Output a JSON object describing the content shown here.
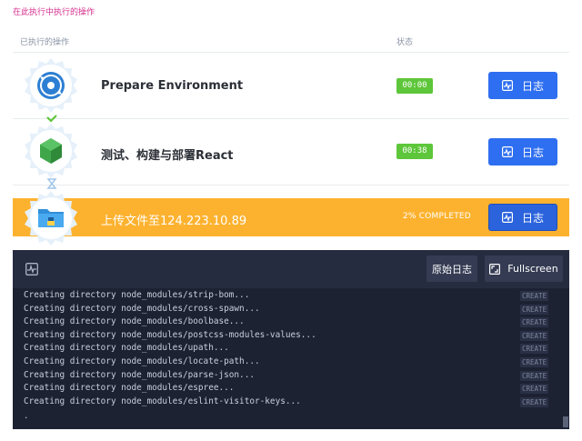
{
  "page": {
    "top_link": "在此执行中执行的操作"
  },
  "table": {
    "col_ops": "已执行的操作",
    "col_status": "状态"
  },
  "steps": [
    {
      "name": "Prepare Environment",
      "status": "00:00",
      "log_label": "日志",
      "icon": "gear-refresh-icon",
      "state": "done"
    },
    {
      "name": "测试、构建与部署React",
      "status": "00:38",
      "log_label": "日志",
      "icon": "node-icon",
      "state": "done"
    },
    {
      "name": "上传文件至124.223.10.89",
      "status": "2% COMPLETED",
      "progress": 0.02,
      "log_label": "日志",
      "icon": "folder-upload-icon",
      "state": "running"
    }
  ],
  "console": {
    "raw_label": "原始日志",
    "fullscreen_label": "Fullscreen",
    "lines": [
      {
        "text": "Creating directory node_modules/strip-bom...",
        "tag": "CREATE"
      },
      {
        "text": "Creating directory node_modules/cross-spawn...",
        "tag": "CREATE"
      },
      {
        "text": "Creating directory node_modules/boolbase...",
        "tag": "CREATE"
      },
      {
        "text": "Creating directory node_modules/postcss-modules-values...",
        "tag": "CREATE"
      },
      {
        "text": "Creating directory node_modules/upath...",
        "tag": "CREATE"
      },
      {
        "text": "Creating directory node_modules/locate-path...",
        "tag": "CREATE"
      },
      {
        "text": "Creating directory node_modules/parse-json...",
        "tag": "CREATE"
      },
      {
        "text": "Creating directory node_modules/espree...",
        "tag": "CREATE"
      },
      {
        "text": "Creating directory node_modules/eslint-visitor-keys...",
        "tag": "CREATE"
      }
    ],
    "trailing": "."
  },
  "colors": {
    "accent": "#2e6ef0",
    "success": "#5dc63a",
    "running": "#fdb22f",
    "console_bg": "#1d2233",
    "link": "#d62f8e"
  }
}
